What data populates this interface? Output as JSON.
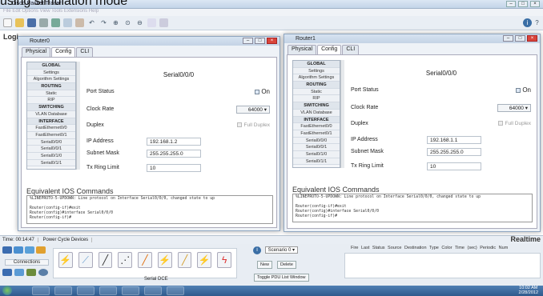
{
  "caption": "using simulation mode",
  "app_title": "Cisco Packet Tracer",
  "menubar_text": "File  Edit  Options  View  Tools  Extensions  Help",
  "logical_label": "Logi",
  "windows": [
    {
      "title": "Router0",
      "tabs": [
        "Physical",
        "Config",
        "CLI"
      ],
      "active_tab": "Config",
      "sidebar": [
        {
          "label": "GLOBAL",
          "kind": "h"
        },
        {
          "label": "Settings",
          "kind": "s"
        },
        {
          "label": "Algorithm Settings",
          "kind": "s"
        },
        {
          "label": "ROUTING",
          "kind": "h"
        },
        {
          "label": "Static",
          "kind": "s"
        },
        {
          "label": "RIP",
          "kind": "s"
        },
        {
          "label": "SWITCHING",
          "kind": "h"
        },
        {
          "label": "VLAN Database",
          "kind": "s"
        },
        {
          "label": "INTERFACE",
          "kind": "h"
        },
        {
          "label": "FastEthernet0/0",
          "kind": "s"
        },
        {
          "label": "FastEthernet0/1",
          "kind": "s"
        },
        {
          "label": "Serial0/0/0",
          "kind": "s"
        },
        {
          "label": "Serial0/0/1",
          "kind": "s"
        },
        {
          "label": "Serial0/1/0",
          "kind": "s"
        },
        {
          "label": "Serial0/1/1",
          "kind": "s"
        }
      ],
      "panel_title": "Serial0/0/0",
      "port_status_label": "Port Status",
      "port_status_value": "On",
      "clock_rate_label": "Clock Rate",
      "clock_rate_value": "64000",
      "duplex_label": "Duplex",
      "duplex_value": "Full Duplex",
      "ip_label": "IP Address",
      "ip_value": "192.168.1.2",
      "mask_label": "Subnet Mask",
      "mask_value": "255.255.255.0",
      "tx_label": "Tx Ring Limit",
      "tx_value": "10",
      "ios_label": "Equivalent IOS Commands",
      "console_lines": [
        "%LINEPROTO-5-UPDOWN: Line protocol on Interface Serial0/0/0, changed state to up",
        "",
        "Router(config-if)#exit",
        "Router(config)#interface Serial0/0/0",
        "Router(config-if)#"
      ]
    },
    {
      "title": "Router1",
      "tabs": [
        "Physical",
        "Config",
        "CLI"
      ],
      "active_tab": "Config",
      "sidebar": [
        {
          "label": "GLOBAL",
          "kind": "h"
        },
        {
          "label": "Settings",
          "kind": "s"
        },
        {
          "label": "Algorithm Settings",
          "kind": "s"
        },
        {
          "label": "ROUTING",
          "kind": "h"
        },
        {
          "label": "Static",
          "kind": "s"
        },
        {
          "label": "RIP",
          "kind": "s"
        },
        {
          "label": "SWITCHING",
          "kind": "h"
        },
        {
          "label": "VLAN Database",
          "kind": "s"
        },
        {
          "label": "INTERFACE",
          "kind": "h"
        },
        {
          "label": "FastEthernet0/0",
          "kind": "s"
        },
        {
          "label": "FastEthernet0/1",
          "kind": "s"
        },
        {
          "label": "Serial0/0/0",
          "kind": "s"
        },
        {
          "label": "Serial0/0/1",
          "kind": "s"
        },
        {
          "label": "Serial0/1/0",
          "kind": "s"
        },
        {
          "label": "Serial0/1/1",
          "kind": "s"
        }
      ],
      "panel_title": "Serial0/0/0",
      "port_status_label": "Port Status",
      "port_status_value": "On",
      "clock_rate_label": "Clock Rate",
      "clock_rate_value": "64000",
      "duplex_label": "Duplex",
      "duplex_value": "Full Duplex",
      "ip_label": "IP Address",
      "ip_value": "192.168.1.1",
      "mask_label": "Subnet Mask",
      "mask_value": "255.255.255.0",
      "tx_label": "Tx Ring Limit",
      "tx_value": "10",
      "ios_label": "Equivalent IOS Commands",
      "console_lines": [
        "%LINEPROTO-5-UPDOWN: Line protocol on Interface Serial0/0/0, changed state to up",
        "",
        "Router(config-if)#exit",
        "Router(config)#interface Serial0/0/0",
        "Router(config-if)#"
      ]
    }
  ],
  "timebar": {
    "time": "Time: 00:14:47",
    "power": "Power Cycle Devices"
  },
  "realtime_label": "Realtime",
  "connections_label": "Connections",
  "serial_dce_label": "Serial DCE",
  "scenario": {
    "value": "Scenario 0",
    "new": "New",
    "delete": "Delete",
    "toggle": "Toggle PDU List Window"
  },
  "pdu_columns": "Fire  Last Status  Source  Destination  Type  Color  Time (sec)  Periodic  Num",
  "clock": {
    "time": "10:02 AM",
    "date": "2/28/2012"
  },
  "colors": {
    "accent": "#3a6ea5",
    "taskbar": "#2f5a8c"
  }
}
